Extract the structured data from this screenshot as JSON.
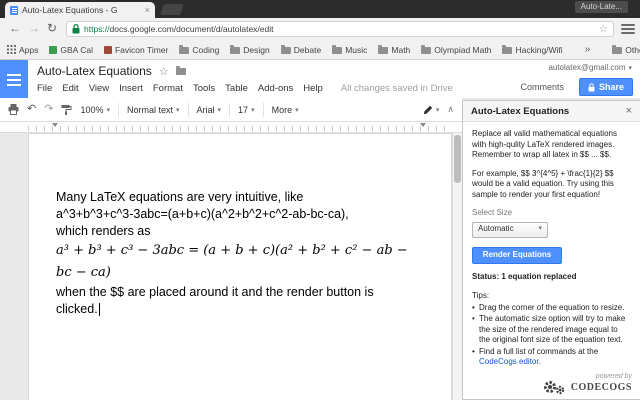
{
  "colors": {
    "accent_blue": "#4d90fe",
    "link_blue": "#1155cc",
    "secure_green": "#0b8043"
  },
  "icons": {
    "close": "×",
    "back": "←",
    "forward": "→",
    "refresh": "↻",
    "star": "☆",
    "dropdown": "▾",
    "undo": "↶",
    "redo": "↷",
    "collapse": "∧",
    "overflow": "»",
    "bullet": "•"
  },
  "browser": {
    "tab_title": "Auto-Latex Equations - G",
    "floating_label": "Auto-Late...",
    "url_scheme": "https://",
    "url_rest": "docs.google.com/document/d/autolatex/edit",
    "bookmarks": [
      {
        "label": "Apps"
      },
      {
        "label": "GBA Cal"
      },
      {
        "label": "Favicon Timer"
      },
      {
        "label": "Coding"
      },
      {
        "label": "Design"
      },
      {
        "label": "Debate"
      },
      {
        "label": "Music"
      },
      {
        "label": "Math"
      },
      {
        "label": "Olympiad Math"
      },
      {
        "label": "Hacking/Wifi"
      }
    ],
    "other_bookmarks": "Other bookmarks"
  },
  "docs": {
    "title": "Auto-Latex Equations",
    "email": "autolatex@gmail.com",
    "menus": [
      "File",
      "Edit",
      "View",
      "Insert",
      "Format",
      "Tools",
      "Table",
      "Add-ons",
      "Help"
    ],
    "save_status": "All changes saved in Drive",
    "comments": "Comments",
    "share": "Share",
    "toolbar": {
      "zoom": "100%",
      "styles": "Normal text",
      "font": "Arial",
      "size": "17",
      "more": "More"
    }
  },
  "document": {
    "line1": "Many LaTeX equations are very intuitive, like",
    "line2": "a^3+b^3+c^3-3abc=(a+b+c)(a^2+b^2+c^2-ab-bc-ca),",
    "line3": "which renders as",
    "equation": "a³ + b³ + c³ − 3abc = (a + b + c)(a² + b² + c² − ab − bc − ca)",
    "line5": "when the $$ are placed around it and the render button is",
    "line6": "clicked."
  },
  "sidebar": {
    "title": "Auto-Latex Equations",
    "para_intro": "Replace all valid mathematical equations with high-qulity LaTeX rendered images. Remember to wrap all latex in $$ ... $$.",
    "para_example": "For example, $$ 3^{4^5} + \\frac{1}{2} $$ would be a valid equation. Try using this sample to render your first equation!",
    "select_size_label": "Select Size",
    "size_value": "Automatic",
    "render_button": "Render Equations",
    "status": "Status: 1 equation replaced",
    "tips_title": "Tips:",
    "tip1": "Drag the corner of the equation to resize.",
    "tip2": "The automatic size option will try to make the size of the rendered image equal to the original font size of the equation text.",
    "tip3_prefix": "Find a full list of commands at the ",
    "tip3_link": "CodeCogs editor.",
    "powered_by": "powered by",
    "brand": "CODECOGS"
  }
}
